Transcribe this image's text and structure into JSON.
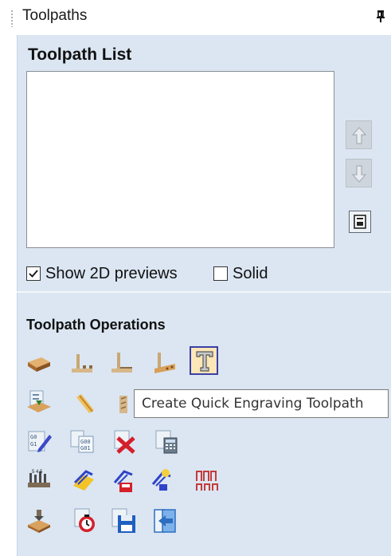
{
  "window": {
    "title": "Toolpaths"
  },
  "toolpath_list": {
    "heading": "Toolpath List",
    "items": []
  },
  "options": {
    "show_2d_previews": {
      "label": "Show 2D previews",
      "checked": true
    },
    "solid": {
      "label": "Solid",
      "checked": false
    }
  },
  "operations": {
    "heading": "Toolpath Operations",
    "tooltip": "Create Quick Engraving Toolpath",
    "highlighted_icon": "quick-engraving-icon"
  },
  "colors": {
    "panel_bg": "#dbe6f2",
    "highlight_bg": "#fde6b7",
    "highlight_border": "#3a40a8"
  }
}
